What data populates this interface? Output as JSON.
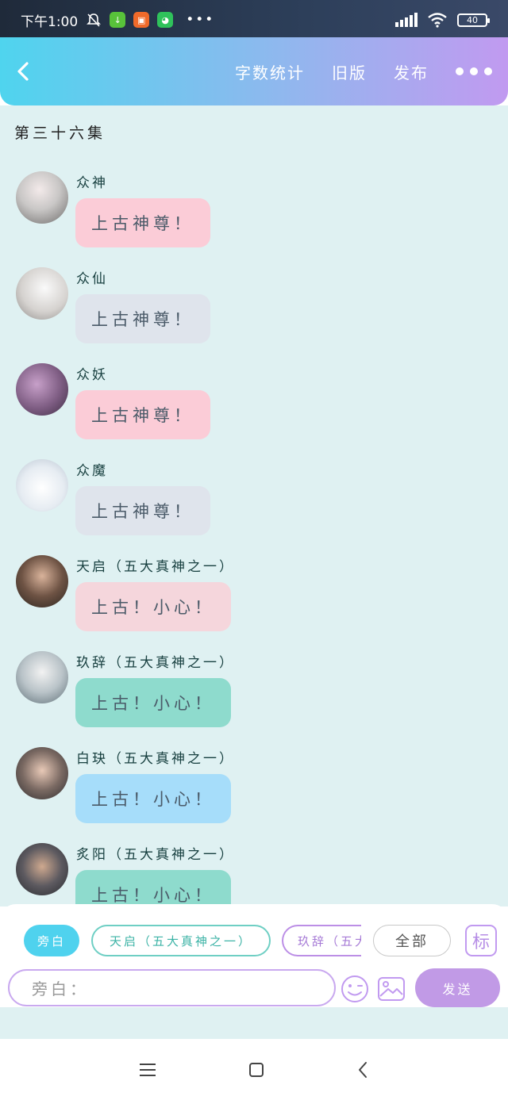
{
  "status_bar": {
    "time": "下午1:00",
    "dots": "•••",
    "battery": "40"
  },
  "header": {
    "back_icon": "‹",
    "word_count": "字数统计",
    "old_version": "旧版",
    "publish": "发布"
  },
  "episode_title": "第三十六集",
  "messages": [
    {
      "sender": "众神",
      "text": "上古神尊！",
      "bubble_color": "#fbccd7"
    },
    {
      "sender": "众仙",
      "text": "上古神尊！",
      "bubble_color": "#dfe4ec"
    },
    {
      "sender": "众妖",
      "text": "上古神尊！",
      "bubble_color": "#fbccd7"
    },
    {
      "sender": "众魔",
      "text": "上古神尊！",
      "bubble_color": "#dfe4ec"
    },
    {
      "sender": "天启（五大真神之一）",
      "text": "上古！小心！",
      "bubble_color": "#f5d6dc"
    },
    {
      "sender": "玖辞（五大真神之一）",
      "text": "上古！小心！",
      "bubble_color": "#8edbcd"
    },
    {
      "sender": "白玦（五大真神之一）",
      "text": "上古！小心！",
      "bubble_color": "#a6ddfa"
    },
    {
      "sender": "炙阳（五大真神之一）",
      "text": "上古！小心！",
      "bubble_color": "#8edbcd"
    }
  ],
  "composer": {
    "chips": {
      "narration": "旁白",
      "tianqi": "天启（五大真神之一）",
      "jiuci": "玖辞（五大真神之一）",
      "all": "全部",
      "mark": "标"
    },
    "input_placeholder": "旁白：",
    "send": "发送"
  }
}
